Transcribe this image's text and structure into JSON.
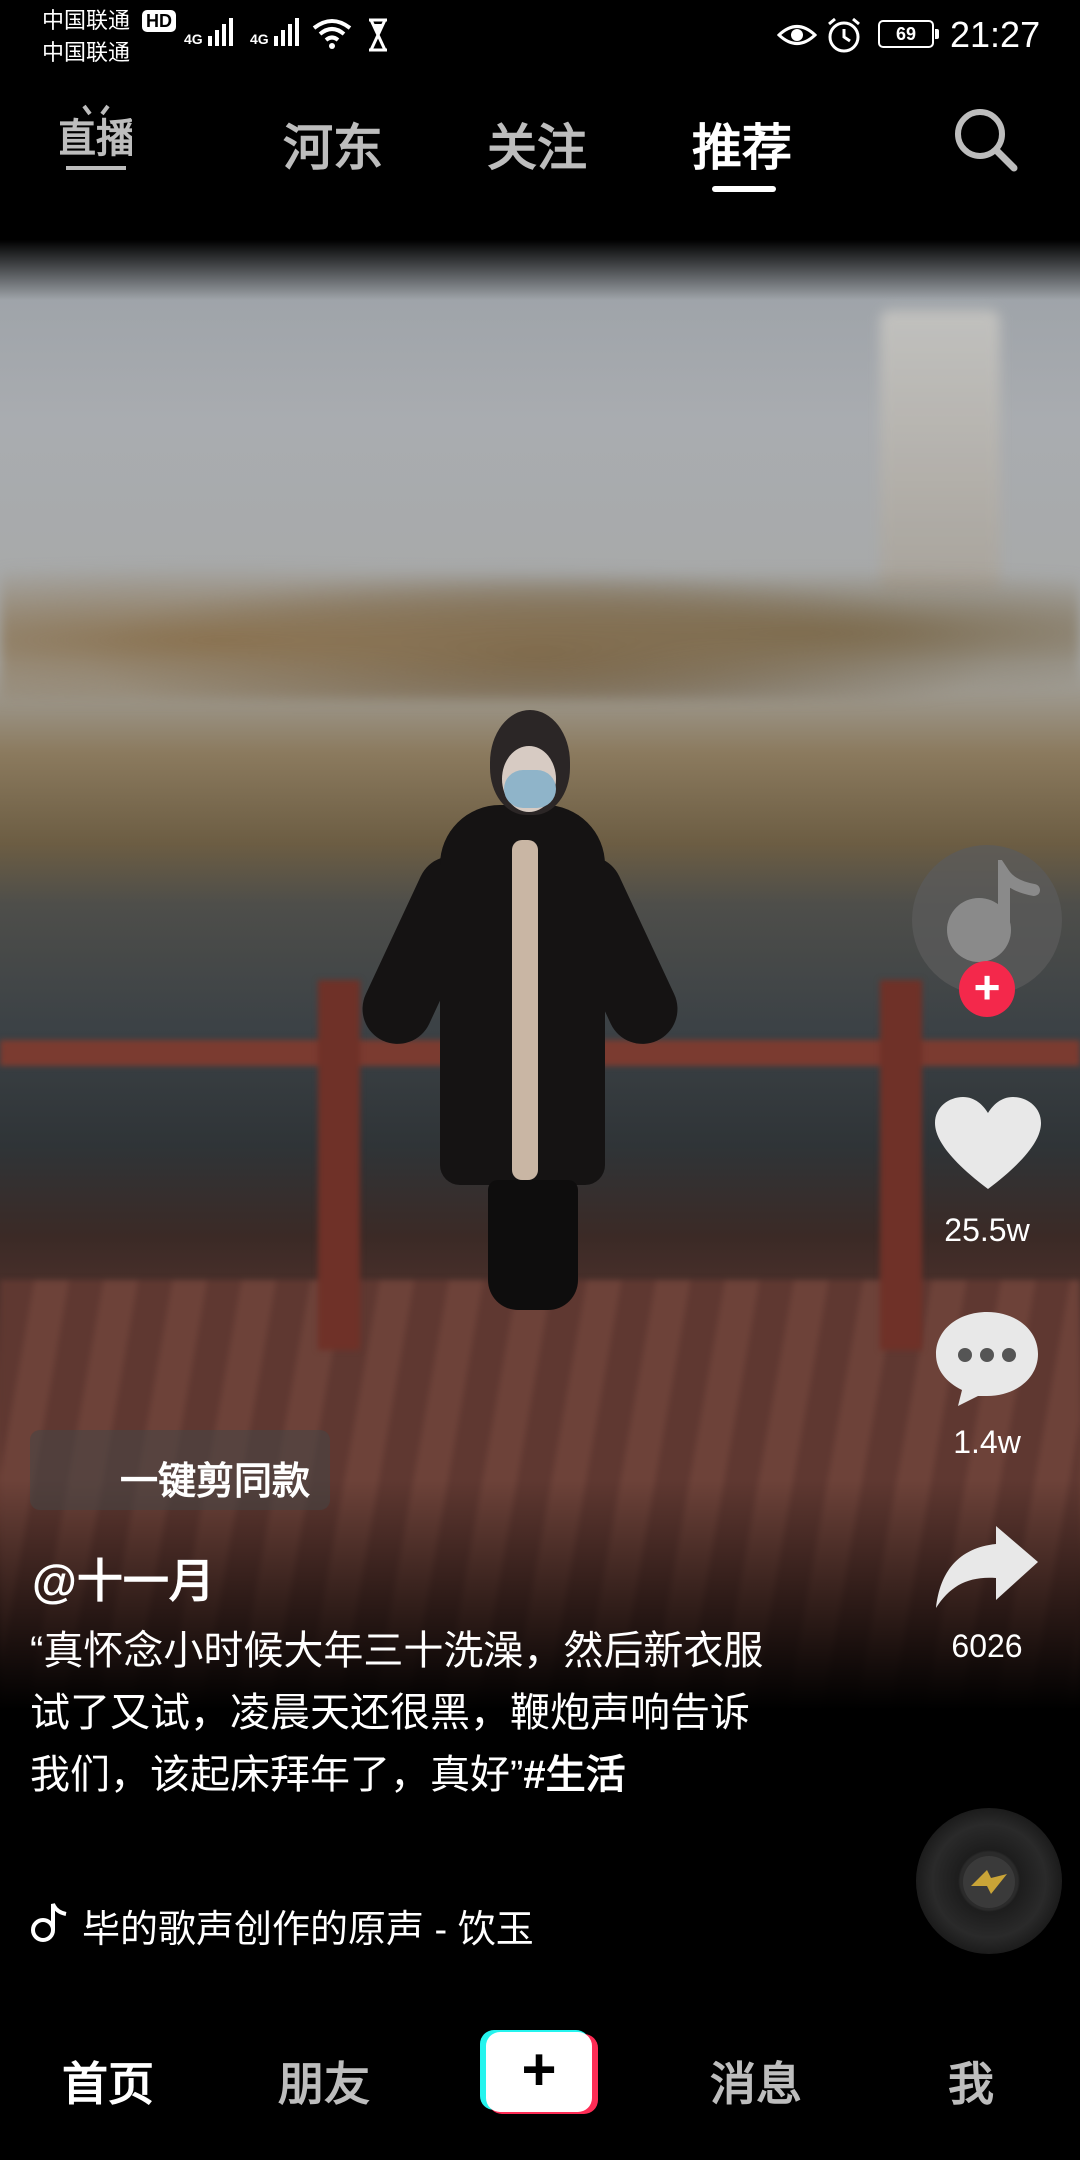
{
  "status_bar": {
    "carrier_1": "中国联通",
    "carrier_2": "中国联通",
    "hd_badge": "HD",
    "network_1": "4G",
    "network_2": "4G",
    "battery": "69",
    "time": "21:27",
    "icons": [
      "signal-icon",
      "wifi-icon",
      "hourglass-icon",
      "eye-icon",
      "alarm-icon",
      "battery-icon"
    ]
  },
  "top_nav": {
    "live_icon_label": "直播",
    "tabs": [
      {
        "label": "河东",
        "active": false
      },
      {
        "label": "关注",
        "active": false
      },
      {
        "label": "推荐",
        "active": true
      }
    ],
    "search_icon": "search-icon"
  },
  "actions": {
    "follow_label": "+",
    "likes": "25.5w",
    "comments": "1.4w",
    "shares": "6026"
  },
  "caption": {
    "template_button": "一键剪同款",
    "author": "@十一月",
    "description": "“真怀念小时候大年三十洗澡，然后新衣服试了又试，凌晨天还很黑，鞭炮声响告诉我们，该起床拜年了，真好”",
    "hashtag": "#生活",
    "sound": "毕的歌声创作的原声 - 饮玉"
  },
  "bottom_nav": {
    "tabs": [
      {
        "label": "首页",
        "active": true
      },
      {
        "label": "朋友",
        "active": false
      },
      {
        "label": "+",
        "active": false
      },
      {
        "label": "消息",
        "active": false
      },
      {
        "label": "我",
        "active": false
      }
    ]
  },
  "colors": {
    "background": "#000000",
    "accent_red": "#fe2c55",
    "accent_cyan": "#25f4ee",
    "follow_red": "#f4284b"
  }
}
